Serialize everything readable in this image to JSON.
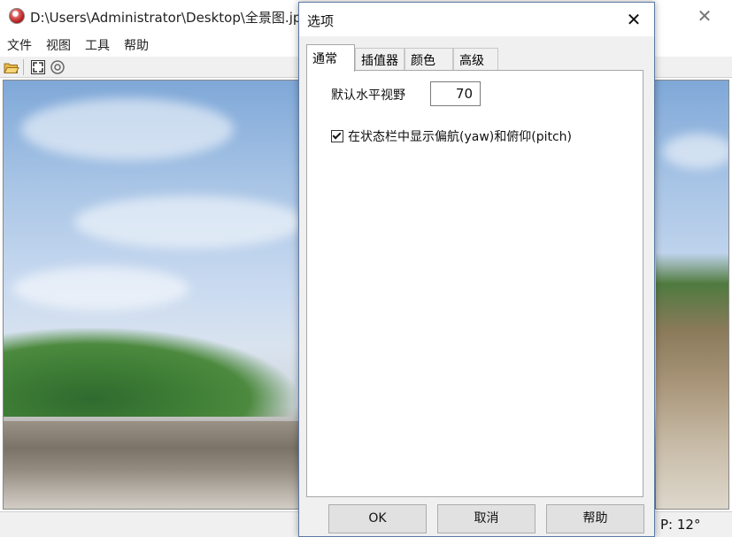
{
  "main_window": {
    "title": "D:\\Users\\Administrator\\Desktop\\全景图.jpg",
    "close_glyph": "✕",
    "menu": [
      "文件",
      "视图",
      "工具",
      "帮助"
    ],
    "toolbar_icons": [
      "open-folder-icon",
      "fullscreen-icon",
      "settings-circle-icon"
    ],
    "status_text": "P: 12°"
  },
  "dialog": {
    "title": "选项",
    "close_glyph": "✕",
    "tabs": [
      {
        "label": "通常",
        "active": true
      },
      {
        "label": "插值器",
        "active": false
      },
      {
        "label": "颜色",
        "active": false
      },
      {
        "label": "高级",
        "active": false
      }
    ],
    "general": {
      "fov_label": "默认水平视野",
      "fov_value": "70",
      "show_yaw_pitch_label": "在状态栏中显示偏航(yaw)和俯仰(pitch)",
      "show_yaw_pitch_checked": true
    },
    "buttons": {
      "ok": "OK",
      "cancel": "取消",
      "help": "帮助"
    }
  },
  "colors": {
    "dialog_border": "#5c7aa3",
    "button_bg": "#e1e1e1",
    "panel_bg": "#ffffff",
    "chrome_bg": "#f0f0f0"
  }
}
